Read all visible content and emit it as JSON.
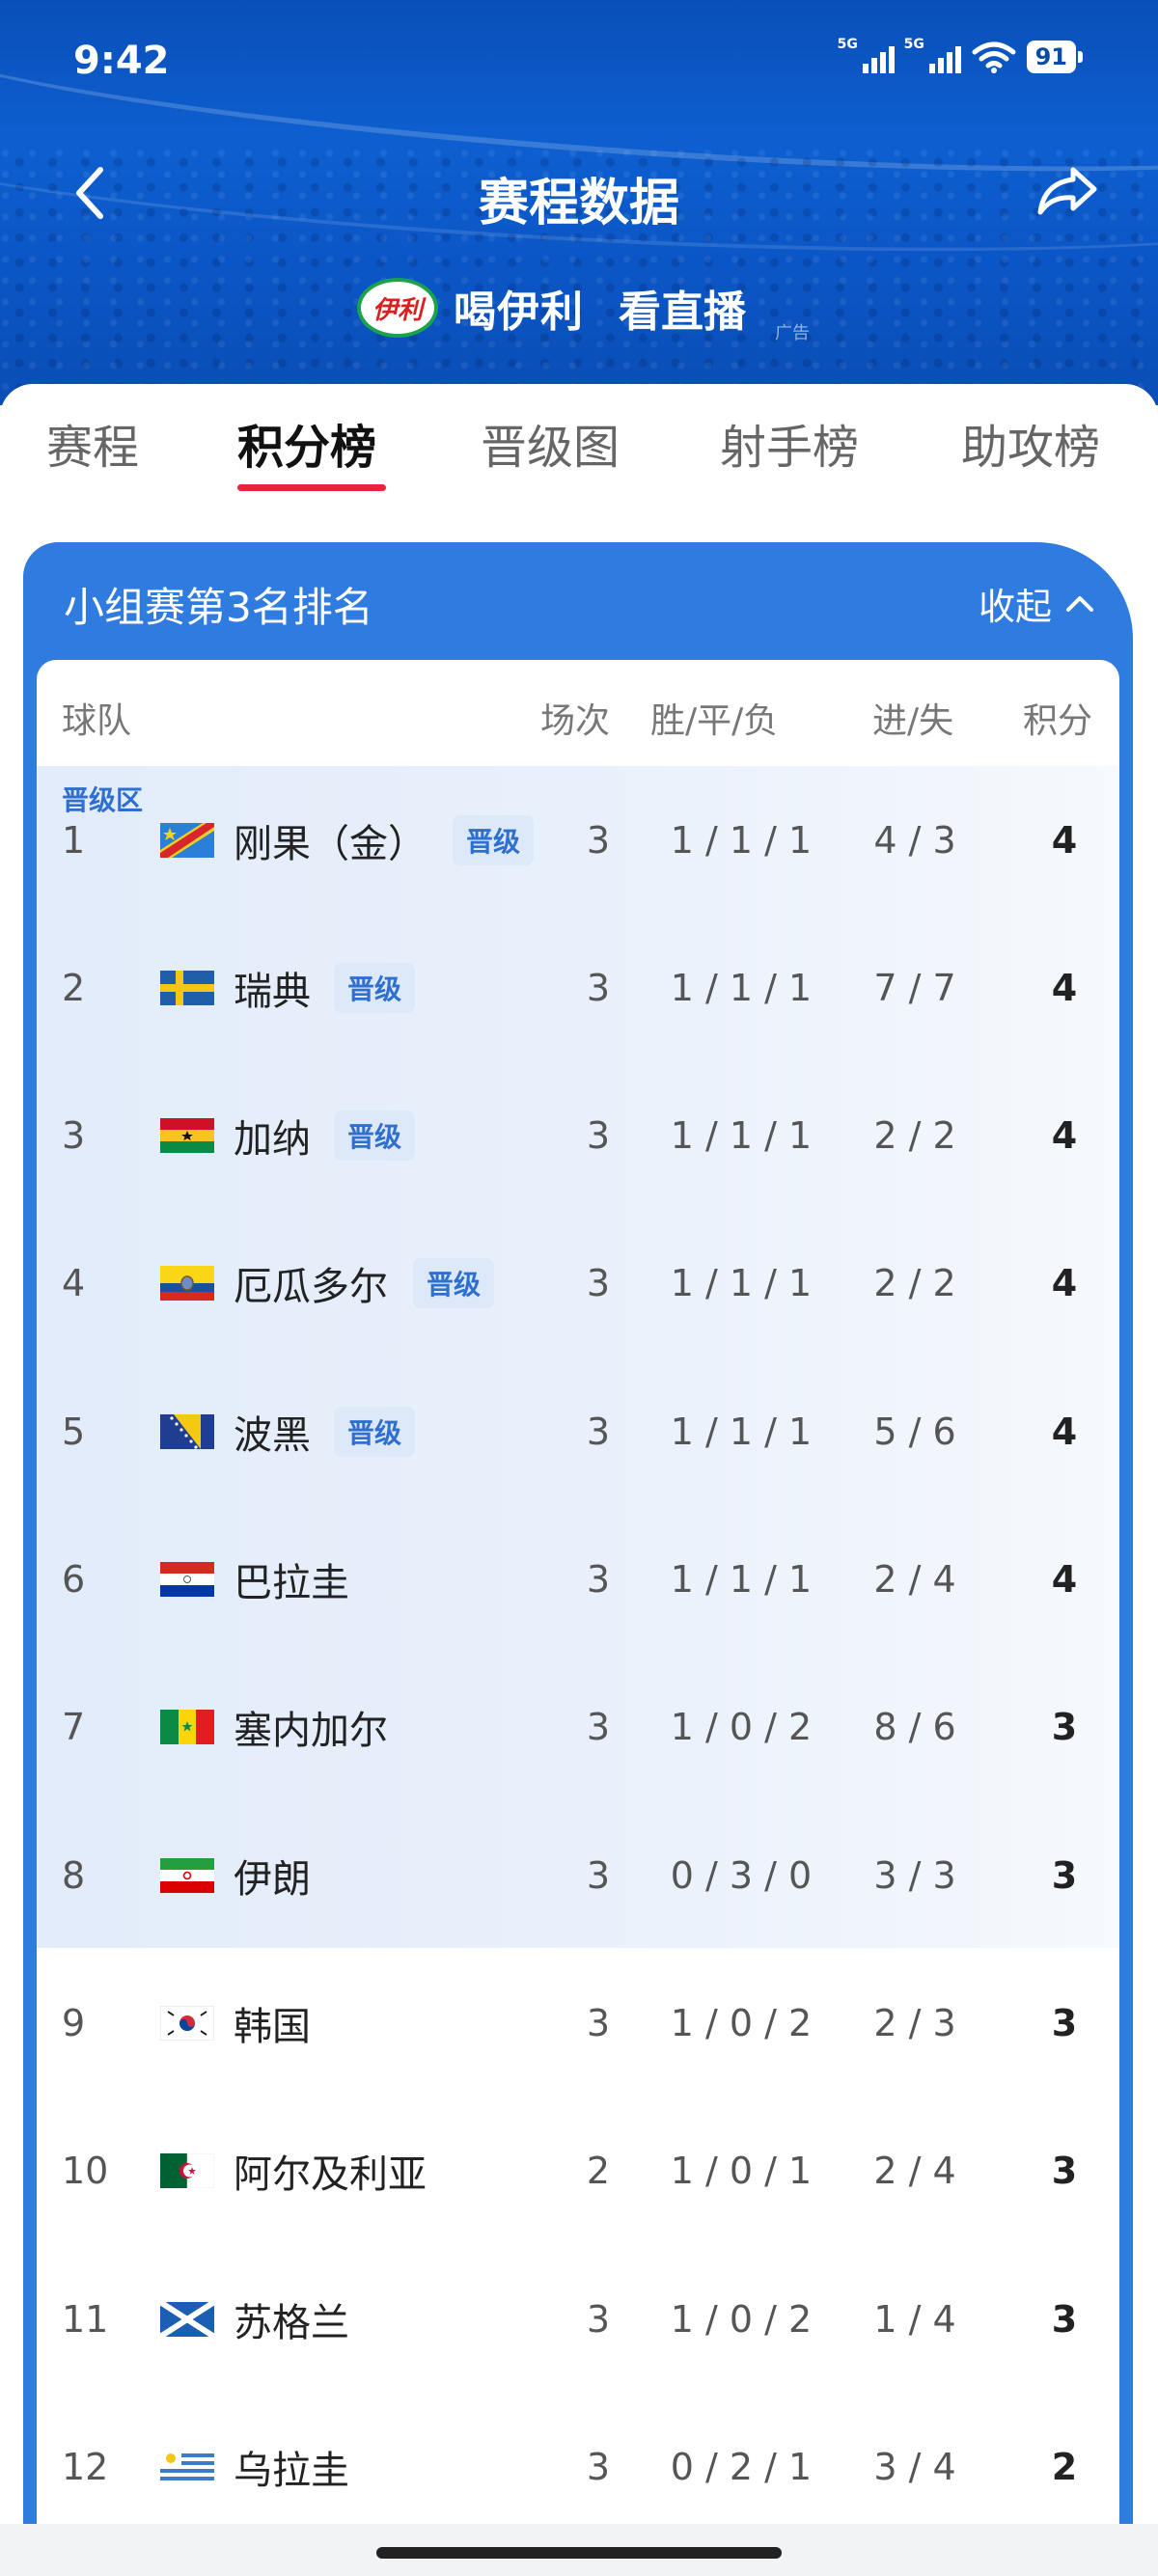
{
  "status_bar": {
    "time": "9:42",
    "signal1": "5G",
    "signal2": "5G",
    "battery": "91"
  },
  "header": {
    "title": "赛程数据"
  },
  "ad": {
    "logo_text": "伊利",
    "text1": "喝伊利",
    "text2": "看直播",
    "tag": "广告"
  },
  "tabs": [
    {
      "label": "赛程",
      "active": false
    },
    {
      "label": "积分榜",
      "active": true
    },
    {
      "label": "晋级图",
      "active": false
    },
    {
      "label": "射手榜",
      "active": false
    },
    {
      "label": "助攻榜",
      "active": false
    }
  ],
  "panel": {
    "title": "小组赛第3名排名",
    "collapse_label": "收起"
  },
  "columns": {
    "team": "球队",
    "played": "场次",
    "wdl": "胜/平/负",
    "goals": "进/失",
    "points": "积分"
  },
  "zone_label": "晋级区",
  "rows": [
    {
      "rank": "1",
      "team": "刚果（金）",
      "flag": "flag-dr-congo",
      "badge": "晋级",
      "played": "3",
      "wdl": "1 / 1 / 1",
      "goals": "4 / 3",
      "points": "4"
    },
    {
      "rank": "2",
      "team": "瑞典",
      "flag": "flag-sweden",
      "badge": "晋级",
      "played": "3",
      "wdl": "1 / 1 / 1",
      "goals": "7 / 7",
      "points": "4"
    },
    {
      "rank": "3",
      "team": "加纳",
      "flag": "flag-ghana",
      "badge": "晋级",
      "played": "3",
      "wdl": "1 / 1 / 1",
      "goals": "2 / 2",
      "points": "4"
    },
    {
      "rank": "4",
      "team": "厄瓜多尔",
      "flag": "flag-ecuador",
      "badge": "晋级",
      "played": "3",
      "wdl": "1 / 1 / 1",
      "goals": "2 / 2",
      "points": "4"
    },
    {
      "rank": "5",
      "team": "波黑",
      "flag": "flag-bosnia",
      "badge": "晋级",
      "played": "3",
      "wdl": "1 / 1 / 1",
      "goals": "5 / 6",
      "points": "4"
    },
    {
      "rank": "6",
      "team": "巴拉圭",
      "flag": "flag-paraguay",
      "badge": "",
      "played": "3",
      "wdl": "1 / 1 / 1",
      "goals": "2 / 4",
      "points": "4"
    },
    {
      "rank": "7",
      "team": "塞内加尔",
      "flag": "flag-senegal",
      "badge": "",
      "played": "3",
      "wdl": "1 / 0 / 2",
      "goals": "8 / 6",
      "points": "3"
    },
    {
      "rank": "8",
      "team": "伊朗",
      "flag": "flag-iran",
      "badge": "",
      "played": "3",
      "wdl": "0 / 3 / 0",
      "goals": "3 / 3",
      "points": "3"
    },
    {
      "rank": "9",
      "team": "韩国",
      "flag": "flag-south-korea",
      "badge": "",
      "played": "3",
      "wdl": "1 / 0 / 2",
      "goals": "2 / 3",
      "points": "3"
    },
    {
      "rank": "10",
      "team": "阿尔及利亚",
      "flag": "flag-algeria",
      "badge": "",
      "played": "2",
      "wdl": "1 / 0 / 1",
      "goals": "2 / 4",
      "points": "3"
    },
    {
      "rank": "11",
      "team": "苏格兰",
      "flag": "flag-scotland",
      "badge": "",
      "played": "3",
      "wdl": "1 / 0 / 2",
      "goals": "1 / 4",
      "points": "3"
    },
    {
      "rank": "12",
      "team": "乌拉圭",
      "flag": "flag-uruguay",
      "badge": "",
      "played": "3",
      "wdl": "0 / 2 / 1",
      "goals": "3 / 4",
      "points": "2"
    }
  ],
  "colors": {
    "header_blue": "#0b56c6",
    "panel_blue": "#2f7be0",
    "tab_accent": "#e8233b",
    "badge_text": "#2f6fcf"
  }
}
